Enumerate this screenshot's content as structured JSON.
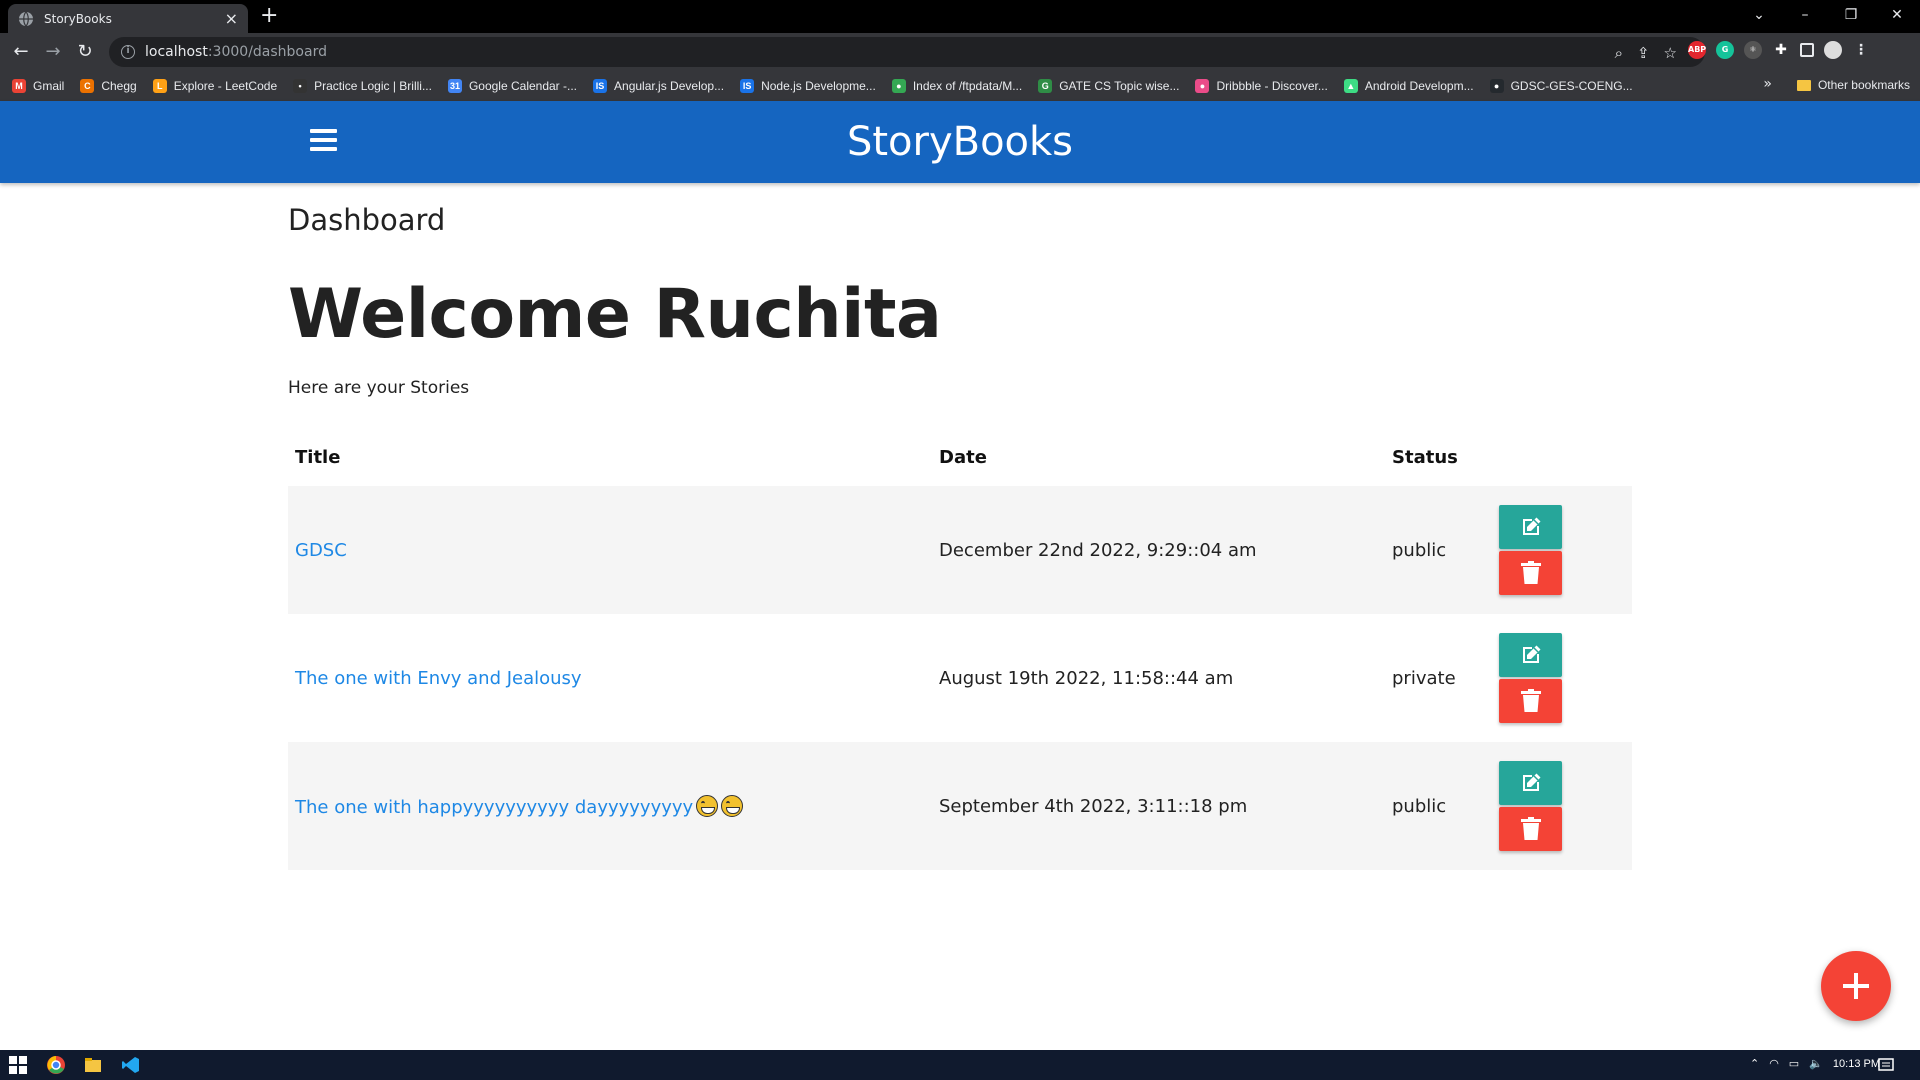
{
  "browser": {
    "tab_title": "StoryBooks",
    "url_host": "localhost",
    "url_path": ":3000/dashboard",
    "bookmarks": [
      {
        "label": "Gmail",
        "color": "#ea4335",
        "glyph": "M"
      },
      {
        "label": "Chegg",
        "color": "#eb7100",
        "glyph": "C"
      },
      {
        "label": "Explore - LeetCode",
        "color": "#ffa116",
        "glyph": "L"
      },
      {
        "label": "Practice Logic | Brilli...",
        "color": "#333333",
        "glyph": "•"
      },
      {
        "label": "Google Calendar -...",
        "color": "#4285f4",
        "glyph": "31"
      },
      {
        "label": "Angular.js Develop...",
        "color": "#1a73e8",
        "glyph": "IS"
      },
      {
        "label": "Node.js Developme...",
        "color": "#1a73e8",
        "glyph": "IS"
      },
      {
        "label": "Index of /ftpdata/M...",
        "color": "#34a853",
        "glyph": "●"
      },
      {
        "label": "GATE CS Topic wise...",
        "color": "#2f8d46",
        "glyph": "G"
      },
      {
        "label": "Dribbble - Discover...",
        "color": "#ea4c89",
        "glyph": "●"
      },
      {
        "label": "Android Developm...",
        "color": "#3ddc84",
        "glyph": "▲"
      },
      {
        "label": "GDSC-GES-COENG...",
        "color": "#24292e",
        "glyph": "●"
      }
    ],
    "other_bookmarks": "Other bookmarks"
  },
  "nav": {
    "brand": "StoryBooks"
  },
  "page": {
    "heading": "Dashboard",
    "welcome": "Welcome Ruchita",
    "subtitle": "Here are your Stories"
  },
  "table": {
    "headers": [
      "Title",
      "Date",
      "Status"
    ],
    "rows": [
      {
        "title": "GDSC",
        "date": "December 22nd 2022, 9:29::04 am",
        "status": "public",
        "emoji": false
      },
      {
        "title": "The one with Envy and Jealousy",
        "date": "August 19th 2022, 11:58::44 am",
        "status": "private",
        "emoji": false
      },
      {
        "title": "The one with happyyyyyyyyyy dayyyyyyyyy",
        "date": "September 4th 2022, 3:11::18 pm",
        "status": "public",
        "emoji": true
      }
    ]
  },
  "taskbar": {
    "time": "10:13 PM"
  },
  "colors": {
    "nav": "#1565c0",
    "edit": "#26a69a",
    "delete": "#f44336",
    "link": "#1e88e5"
  },
  "icons": {
    "hamburger": "menu-icon",
    "edit": "edit-icon",
    "delete": "trash-icon",
    "fab": "plus-icon"
  }
}
